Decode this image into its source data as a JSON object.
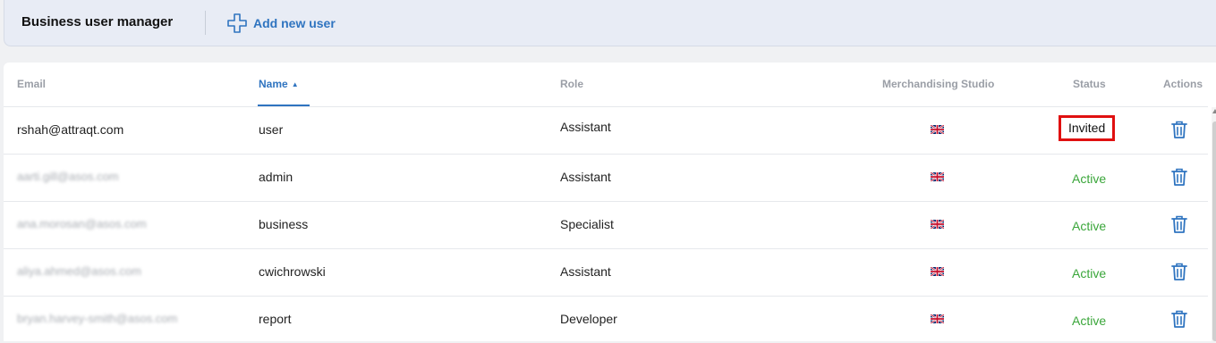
{
  "header": {
    "title": "Business user manager",
    "add_user_label": "Add new user"
  },
  "colors": {
    "accent": "#2f74c0",
    "active_status": "#3aa63a",
    "highlight_box": "#e01010"
  },
  "table": {
    "columns": {
      "email": "Email",
      "name": "Name",
      "role": "Role",
      "studio": "Merchandising Studio",
      "status": "Status",
      "actions": "Actions"
    },
    "sort": {
      "column": "Name",
      "direction": "ascending"
    },
    "rows": [
      {
        "email": "rshah@attraqt.com",
        "email_blurred": false,
        "name": "user",
        "role": "Assistant",
        "studio_icon": "uk-flag-icon",
        "status": "Invited"
      },
      {
        "email": "aarti.gill@asos.com",
        "email_blurred": true,
        "name": "admin",
        "role": "Assistant",
        "studio_icon": "uk-flag-icon",
        "status": "Active"
      },
      {
        "email": "ana.morosan@asos.com",
        "email_blurred": true,
        "name": "business",
        "role": "Specialist",
        "studio_icon": "uk-flag-icon",
        "status": "Active"
      },
      {
        "email": "aliya.ahmed@asos.com",
        "email_blurred": true,
        "name": "cwichrowski",
        "role": "Assistant",
        "studio_icon": "uk-flag-icon",
        "status": "Active"
      },
      {
        "email": "bryan.harvey-smith@asos.com",
        "email_blurred": true,
        "name": "report",
        "role": "Developer",
        "studio_icon": "uk-flag-icon",
        "status": "Active"
      }
    ]
  }
}
